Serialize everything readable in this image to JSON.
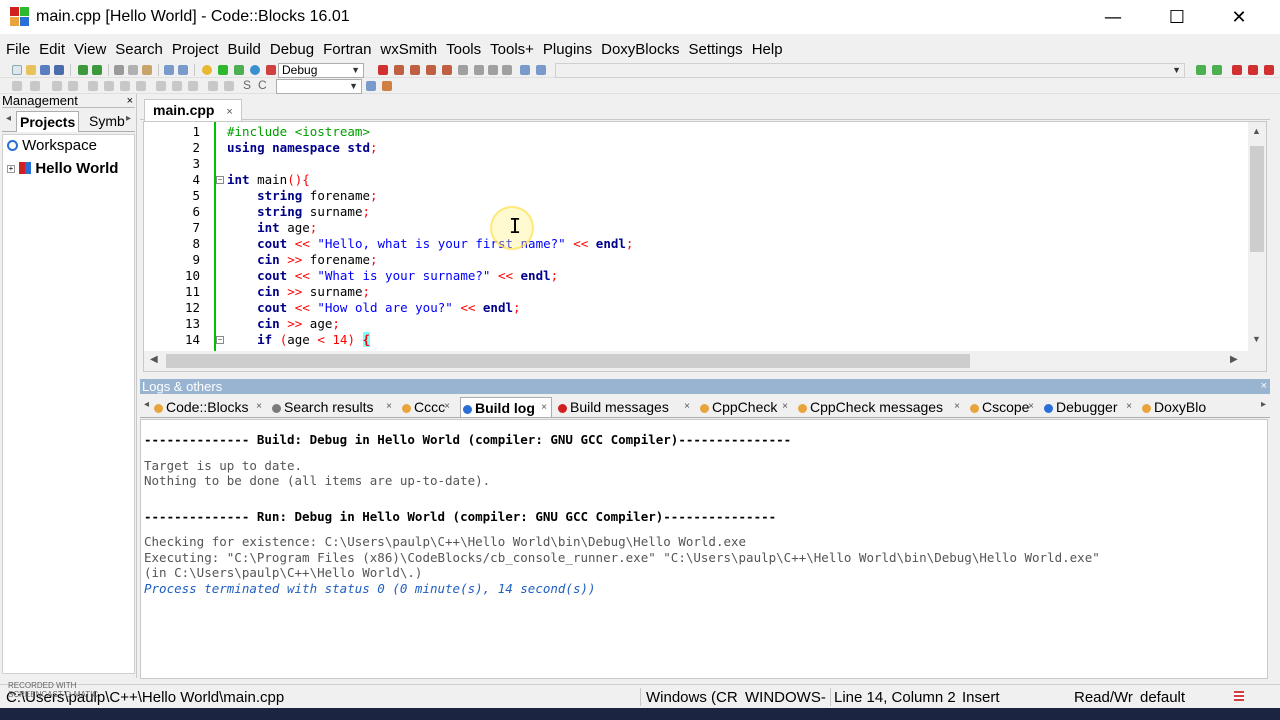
{
  "window": {
    "title": "main.cpp [Hello World] - Code::Blocks 16.01",
    "minimize_glyph": "—",
    "maximize_glyph": "☐",
    "close_glyph": "✕"
  },
  "menu": [
    "File",
    "Edit",
    "View",
    "Search",
    "Project",
    "Build",
    "Debug",
    "Fortran",
    "wxSmith",
    "Tools",
    "Tools+",
    "Plugins",
    "DoxyBlocks",
    "Settings",
    "Help"
  ],
  "toolbar": {
    "build_target": "Debug",
    "search_s": "S",
    "search_c": "C",
    "icon_names": [
      "new-file-icon",
      "open-icon",
      "save-icon",
      "save-all-icon",
      "undo-icon",
      "redo-icon",
      "cut-icon",
      "copy-icon",
      "paste-icon",
      "find-icon",
      "replace-icon",
      "build-icon",
      "run-icon",
      "build-run-icon",
      "rebuild-icon",
      "abort-icon",
      "debug-run-icon"
    ]
  },
  "management": {
    "title": "Management",
    "close": "×",
    "tabs": [
      "Projects",
      "Symb"
    ],
    "tab_arrow_left": "◂",
    "tab_arrow_right": "▸",
    "tree": {
      "workspace": "Workspace",
      "project": "Hello World"
    }
  },
  "editor": {
    "tab_label": "main.cpp",
    "tab_close": "×",
    "lines": [
      {
        "n": "1",
        "parts": [
          {
            "t": "#include <iostream>",
            "c": "pp"
          }
        ]
      },
      {
        "n": "2",
        "parts": [
          {
            "t": "using namespace std",
            "c": "kw"
          },
          {
            "t": ";",
            "c": "op"
          }
        ]
      },
      {
        "n": "3",
        "parts": []
      },
      {
        "n": "4",
        "fold": "−",
        "parts": [
          {
            "t": "int",
            "c": "kw"
          },
          {
            "t": " main",
            "c": ""
          },
          {
            "t": "(){",
            "c": "op"
          }
        ]
      },
      {
        "n": "5",
        "parts": [
          {
            "t": "    ",
            "c": ""
          },
          {
            "t": "string",
            "c": "kw"
          },
          {
            "t": " forename",
            "c": ""
          },
          {
            "t": ";",
            "c": "op"
          }
        ]
      },
      {
        "n": "6",
        "parts": [
          {
            "t": "    ",
            "c": ""
          },
          {
            "t": "string",
            "c": "kw"
          },
          {
            "t": " surname",
            "c": ""
          },
          {
            "t": ";",
            "c": "op"
          }
        ]
      },
      {
        "n": "7",
        "parts": [
          {
            "t": "    ",
            "c": ""
          },
          {
            "t": "int",
            "c": "kw"
          },
          {
            "t": " age",
            "c": ""
          },
          {
            "t": ";",
            "c": "op"
          }
        ]
      },
      {
        "n": "8",
        "parts": [
          {
            "t": "    ",
            "c": ""
          },
          {
            "t": "cout",
            "c": "kw"
          },
          {
            "t": " << ",
            "c": "op"
          },
          {
            "t": "\"Hello, what is your first name?\"",
            "c": "str"
          },
          {
            "t": " << ",
            "c": "op"
          },
          {
            "t": "endl",
            "c": "kw"
          },
          {
            "t": ";",
            "c": "op"
          }
        ]
      },
      {
        "n": "9",
        "parts": [
          {
            "t": "    ",
            "c": ""
          },
          {
            "t": "cin",
            "c": "kw"
          },
          {
            "t": " >> ",
            "c": "op"
          },
          {
            "t": "forename",
            "c": ""
          },
          {
            "t": ";",
            "c": "op"
          }
        ]
      },
      {
        "n": "10",
        "parts": [
          {
            "t": "    ",
            "c": ""
          },
          {
            "t": "cout",
            "c": "kw"
          },
          {
            "t": " << ",
            "c": "op"
          },
          {
            "t": "\"What is your surname?\"",
            "c": "str"
          },
          {
            "t": " << ",
            "c": "op"
          },
          {
            "t": "endl",
            "c": "kw"
          },
          {
            "t": ";",
            "c": "op"
          }
        ]
      },
      {
        "n": "11",
        "parts": [
          {
            "t": "    ",
            "c": ""
          },
          {
            "t": "cin",
            "c": "kw"
          },
          {
            "t": " >> ",
            "c": "op"
          },
          {
            "t": "surname",
            "c": ""
          },
          {
            "t": ";",
            "c": "op"
          }
        ]
      },
      {
        "n": "12",
        "parts": [
          {
            "t": "    ",
            "c": ""
          },
          {
            "t": "cout",
            "c": "kw"
          },
          {
            "t": " << ",
            "c": "op"
          },
          {
            "t": "\"How old are you?\"",
            "c": "str"
          },
          {
            "t": " << ",
            "c": "op"
          },
          {
            "t": "endl",
            "c": "kw"
          },
          {
            "t": ";",
            "c": "op"
          }
        ]
      },
      {
        "n": "13",
        "parts": [
          {
            "t": "    ",
            "c": ""
          },
          {
            "t": "cin",
            "c": "kw"
          },
          {
            "t": " >> ",
            "c": "op"
          },
          {
            "t": "age",
            "c": ""
          },
          {
            "t": ";",
            "c": "op"
          }
        ]
      },
      {
        "n": "14",
        "fold": "−",
        "parts": [
          {
            "t": "    ",
            "c": ""
          },
          {
            "t": "if",
            "c": "kw"
          },
          {
            "t": " (",
            "c": "op"
          },
          {
            "t": "age",
            "c": ""
          },
          {
            "t": " < ",
            "c": "op"
          },
          {
            "t": "14",
            "c": "op"
          },
          {
            "t": ") ",
            "c": "op"
          },
          {
            "t": "{",
            "c": "brace-hl"
          }
        ]
      }
    ]
  },
  "logs": {
    "title": "Logs & others",
    "close": "×",
    "tab_arrow_left": "◂",
    "tab_arrow_right": "▸",
    "tabs": [
      {
        "label": "Code::Blocks",
        "active": false,
        "icon_color": "#e8a33c"
      },
      {
        "label": "Search results",
        "active": false,
        "icon_color": "#7a7a7a"
      },
      {
        "label": "Cccc",
        "active": false,
        "icon_color": "#e8a33c"
      },
      {
        "label": "Build log",
        "active": true,
        "icon_color": "#2a6fd6"
      },
      {
        "label": "Build messages",
        "active": false,
        "icon_color": "#d02020"
      },
      {
        "label": "CppCheck",
        "active": false,
        "icon_color": "#e8a33c"
      },
      {
        "label": "CppCheck messages",
        "active": false,
        "icon_color": "#e8a33c"
      },
      {
        "label": "Cscope",
        "active": false,
        "icon_color": "#e8a33c"
      },
      {
        "label": "Debugger",
        "active": false,
        "icon_color": "#2a6fd6"
      },
      {
        "label": "DoxyBlo",
        "active": false,
        "icon_color": "#e8a33c"
      }
    ],
    "lines": [
      {
        "text": "",
        "style": ""
      },
      {
        "text": "-------------- Build: Debug in Hello World (compiler: GNU GCC Compiler)---------------",
        "style": "bold"
      },
      {
        "text": "",
        "style": ""
      },
      {
        "text": "Target is up to date.",
        "style": ""
      },
      {
        "text": "Nothing to be done (all items are up-to-date).",
        "style": ""
      },
      {
        "text": "",
        "style": ""
      },
      {
        "text": "",
        "style": ""
      },
      {
        "text": "-------------- Run: Debug in Hello World (compiler: GNU GCC Compiler)---------------",
        "style": "bold"
      },
      {
        "text": "",
        "style": ""
      },
      {
        "text": "Checking for existence: C:\\Users\\paulp\\C++\\Hello World\\bin\\Debug\\Hello World.exe",
        "style": ""
      },
      {
        "text": "Executing: \"C:\\Program Files (x86)\\CodeBlocks/cb_console_runner.exe\" \"C:\\Users\\paulp\\C++\\Hello World\\bin\\Debug\\Hello World.exe\"",
        "style": ""
      },
      {
        "text": "(in C:\\Users\\paulp\\C++\\Hello World\\.)",
        "style": ""
      },
      {
        "text": "Process terminated with status 0 (0 minute(s), 14 second(s))",
        "style": "status"
      }
    ]
  },
  "statusbar": {
    "file_path": "C:\\Users\\paulp\\C++\\Hello World\\main.cpp",
    "line_endings": "Windows (CR",
    "encoding": "WINDOWS-",
    "position": "Line 14, Column 2",
    "mode": "Insert",
    "access": "Read/Wr",
    "highlight": "default"
  },
  "watermark": {
    "line1": "RECORDED WITH",
    "line2": "SCREENCAST-O-MATIC"
  },
  "colors": {
    "keyword": "#00008b",
    "preprocessor": "#00a000",
    "string": "#0000ff",
    "operator": "#ff0000",
    "logs_header": "#99b4d1",
    "status_text": "#2060c0"
  }
}
